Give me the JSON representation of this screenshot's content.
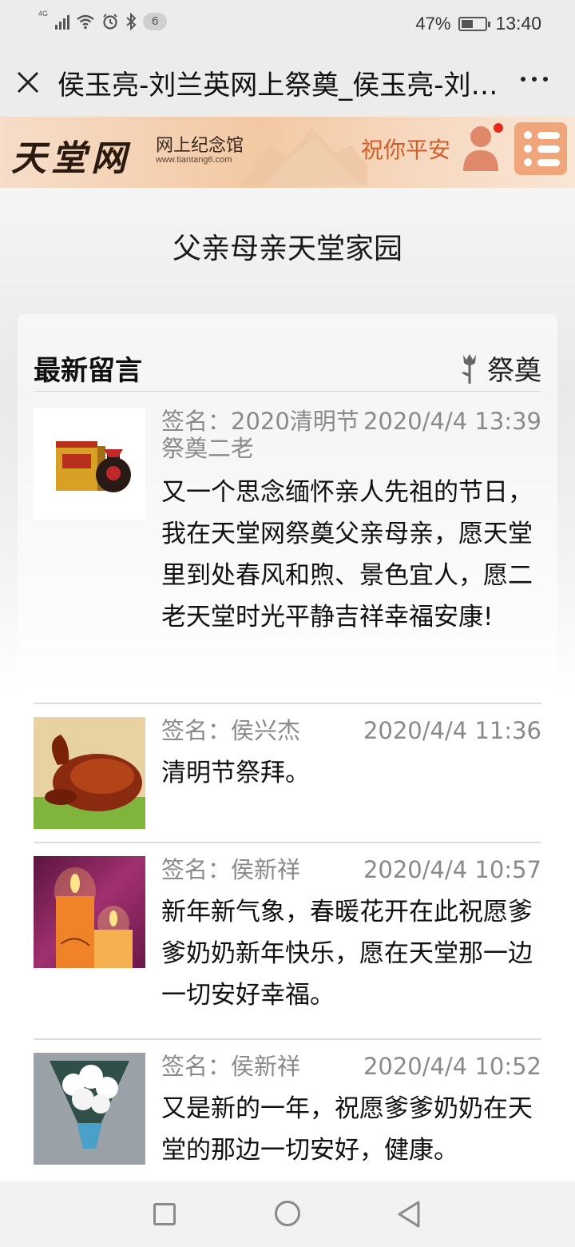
{
  "status_bar": {
    "network": "4G",
    "notification_count": "6",
    "battery": "47%",
    "battery_level": 0.47,
    "time": "13:40"
  },
  "title_bar": {
    "title": "侯玉亮-刘兰英网上祭奠_侯玉亮-刘兰英网上纪念馆"
  },
  "site_header": {
    "logo_text": "天堂网",
    "logo_subtitle": "网上纪念馆",
    "logo_url": "www.tiantang6.com",
    "greeting": "祝你平安"
  },
  "memorial": {
    "title": "父亲母亲天堂家园"
  },
  "messages_section": {
    "title": "最新留言",
    "tribute_label": "祭奠"
  },
  "messages": [
    {
      "signature": "签名：2020清明节祭奠二老",
      "date": "2020/4/4 13:39",
      "body": "又一个思念缅怀亲人先祖的节日，我在天堂网祭奠父亲母亲，愿天堂里到处春风和煦、景色宜人，愿二老天堂时光平静吉祥幸福安康!",
      "thumb": "liquor-gift-box"
    },
    {
      "signature": "签名：侯兴杰",
      "date": "2020/4/4 11:36",
      "body": "清明节祭拜。",
      "thumb": "roast-chicken"
    },
    {
      "signature": "签名：侯新祥",
      "date": "2020/4/4 10:57",
      "body": "新年新气象，春暖花开在此祝愿爹爹奶奶新年快乐，愿在天堂那一边一切安好幸福。",
      "thumb": "candles"
    },
    {
      "signature": "签名：侯新祥",
      "date": "2020/4/4 10:52",
      "body": "又是新的一年，祝愿爹爹奶奶在天堂的那边一切安好，健康。",
      "thumb": "white-flower-bouquet"
    }
  ],
  "colors": {
    "greeting": "#d25e2a",
    "menu_button": "#f0a67a",
    "notification_dot": "#e8291c"
  }
}
